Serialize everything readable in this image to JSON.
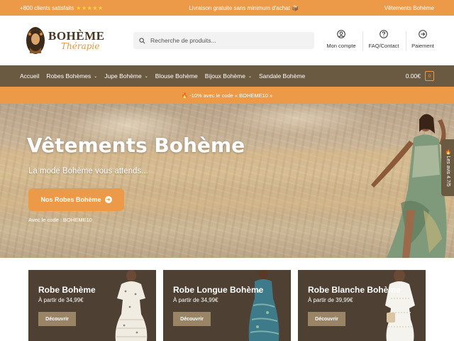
{
  "topbar": {
    "left_text": "+800 clients satisfaits",
    "stars": "★★★★★",
    "center_text": "Livraison gratuite sans minimum d'achat 📦",
    "right_text": "Vêtements Bohème"
  },
  "logo": {
    "title": "BOHÈME",
    "subtitle": "Thérapie"
  },
  "search": {
    "placeholder": "Recherche de produits..."
  },
  "header_nav": [
    {
      "label": "Mon compte",
      "icon": "account-icon"
    },
    {
      "label": "FAQ/Contact",
      "icon": "help-icon"
    },
    {
      "label": "Paiement",
      "icon": "arrow-circle-icon"
    }
  ],
  "nav": {
    "items": [
      {
        "label": "Accueil",
        "has_dropdown": false
      },
      {
        "label": "Robes Bohèmes",
        "has_dropdown": true
      },
      {
        "label": "Jupe Bohème",
        "has_dropdown": true
      },
      {
        "label": "Blouse Bohème",
        "has_dropdown": false
      },
      {
        "label": "Bijoux Bohème",
        "has_dropdown": true
      },
      {
        "label": "Sandale Bohème",
        "has_dropdown": false
      }
    ],
    "chevron": "⌄",
    "cart_total": "0.00€",
    "cart_count": "0"
  },
  "promo": {
    "text": "🔥 -10% avec le code « BOHEME10 »"
  },
  "hero": {
    "title": "Vêtements Bohème",
    "tagline": "La mode Bohème vous attends...",
    "cta_label": "Nos Robes Bohème",
    "cta_arrow": "➜",
    "code_text": "Avec le code : BOHEME10"
  },
  "reviews_tab": {
    "label": "🔥 Les avis 4.7/5"
  },
  "cards": [
    {
      "title": "Robe Bohème",
      "price": "À partir de 34,99€",
      "button": "Découvrir"
    },
    {
      "title": "Robe Longue Bohème",
      "price": "À partir de 34,99€",
      "button": "Découvrir"
    },
    {
      "title": "Robe Blanche Bohème",
      "price": "À partir de 39,99€",
      "button": "Découvrir"
    }
  ],
  "colors": {
    "accent_orange": "#ec9a48",
    "nav_brown": "#6b5a42",
    "card_brown": "#4e4032",
    "button_tan": "#9a8466"
  }
}
